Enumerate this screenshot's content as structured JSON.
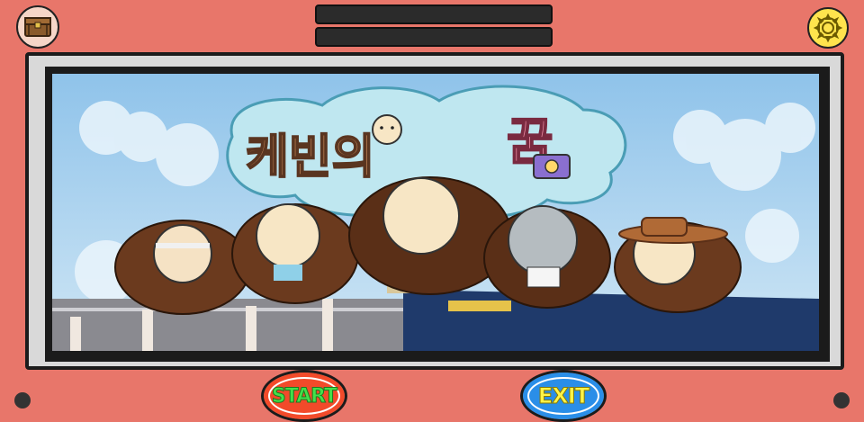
{
  "top_bars": [
    "",
    ""
  ],
  "title_cloud": {
    "text_main": "케빈의",
    "text_dream": "꿈"
  },
  "buttons": {
    "start_label": "START",
    "exit_label": "EXIT"
  },
  "icons": {
    "top_left": "treasure-chest-icon",
    "top_right": "gear-icon"
  },
  "colors": {
    "frame": "#e8766a",
    "start": "#f24a2a",
    "exit": "#2a8ee8",
    "settings": "#ffe44d"
  }
}
